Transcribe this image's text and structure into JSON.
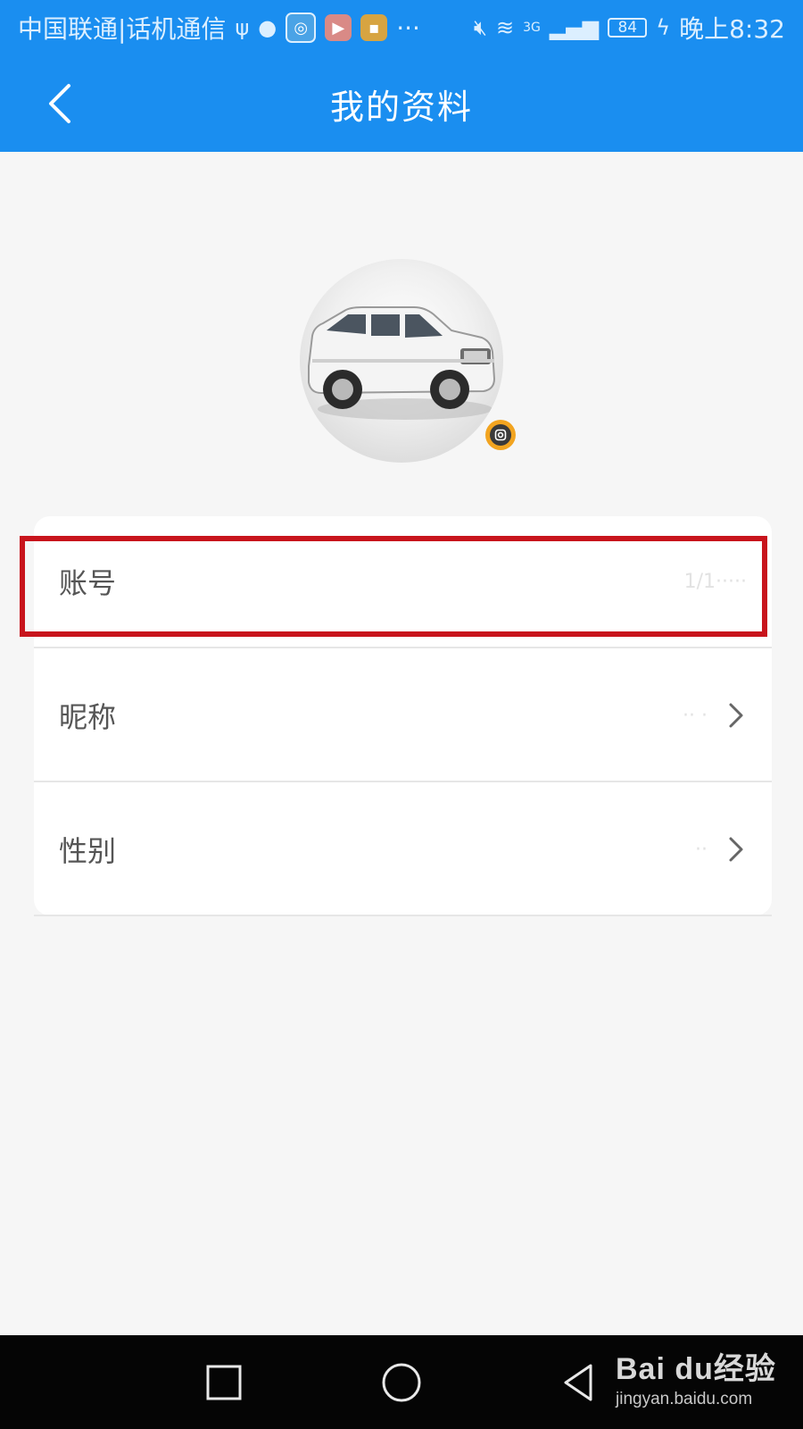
{
  "status_bar": {
    "carrier": "中国联通|话机通信",
    "more": "···",
    "network": "3G",
    "battery": "84",
    "time": "晚上8:32"
  },
  "header": {
    "title": "我的资料"
  },
  "profile": {
    "rows": [
      {
        "label": "账号",
        "value": "1/1·····",
        "has_chevron": false
      },
      {
        "label": "昵称",
        "value": "·· ·",
        "has_chevron": true
      },
      {
        "label": "性别",
        "value": "··",
        "has_chevron": true
      }
    ]
  },
  "watermark": {
    "brand": "Bai du经验",
    "url": "jingyan.baidu.com"
  },
  "colors": {
    "header_bg": "#1a8ef0",
    "page_bg": "#f6f6f6",
    "highlight": "#c8141c",
    "camera_badge": "#f2a420"
  }
}
